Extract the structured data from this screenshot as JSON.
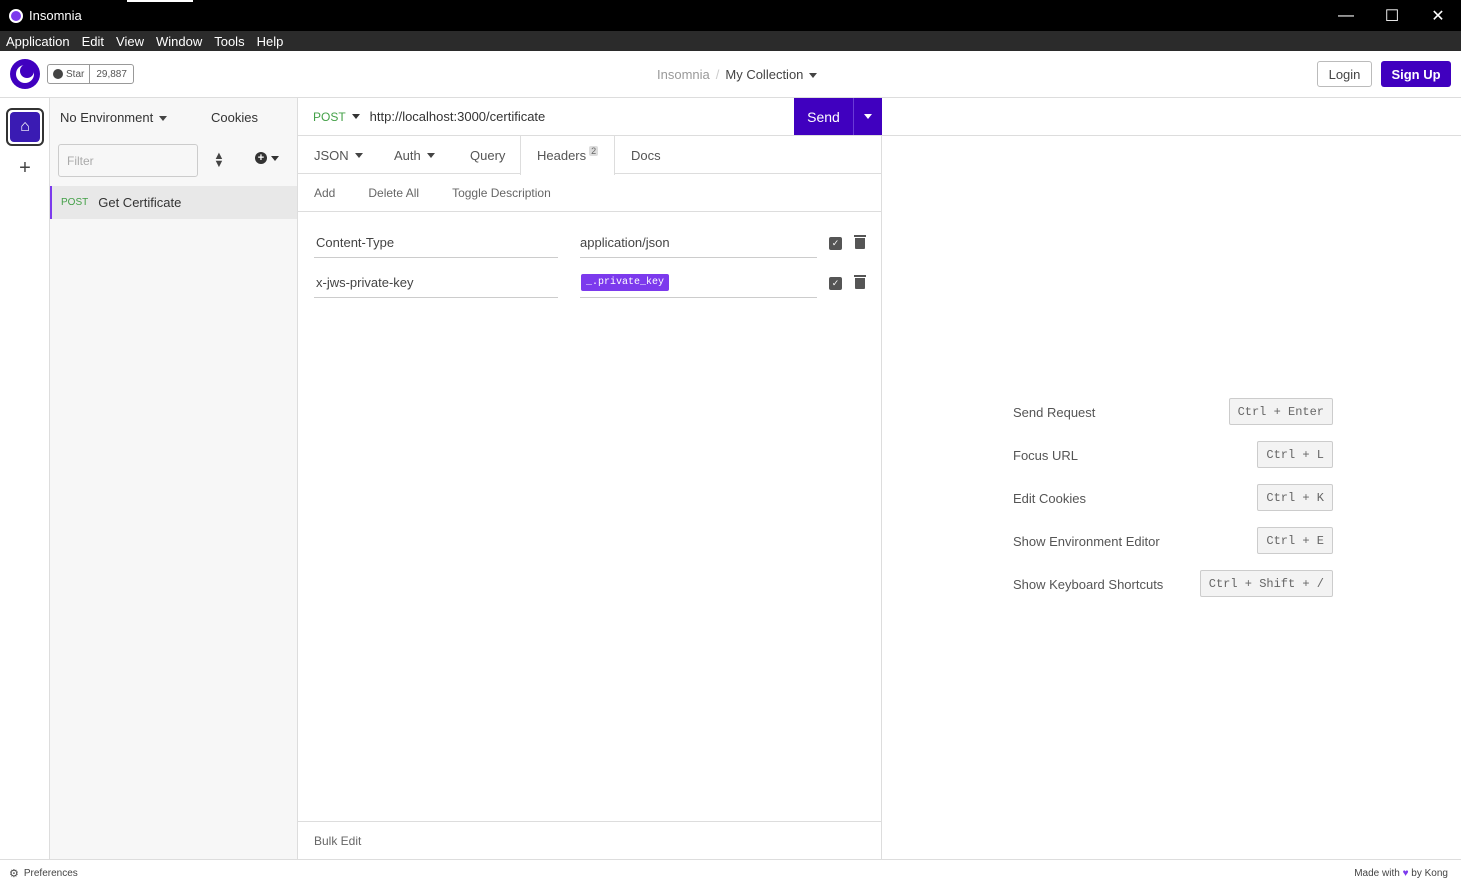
{
  "window": {
    "title": "Insomnia",
    "minimize": "—",
    "maximize": "☐",
    "close": "✕"
  },
  "menu": [
    "Application",
    "Edit",
    "View",
    "Window",
    "Tools",
    "Help"
  ],
  "header": {
    "star_label": "Star",
    "star_count": "29,887",
    "breadcrumb_app": "Insomnia",
    "breadcrumb_sep": "/",
    "breadcrumb_collection": "My Collection",
    "login": "Login",
    "signup": "Sign Up"
  },
  "sidebar": {
    "environment": "No Environment",
    "cookies": "Cookies",
    "filter_placeholder": "Filter",
    "requests": [
      {
        "method": "POST",
        "name": "Get Certificate"
      }
    ]
  },
  "request": {
    "method": "POST",
    "url": "http://localhost:3000/certificate",
    "send": "Send",
    "tabs": {
      "body": "JSON",
      "auth": "Auth",
      "query": "Query",
      "headers": "Headers",
      "headers_count": "2",
      "docs": "Docs"
    },
    "actions": {
      "add": "Add",
      "delete_all": "Delete All",
      "toggle_description": "Toggle Description"
    },
    "headers": [
      {
        "name": "Content-Type",
        "value": "application/json"
      },
      {
        "name": "x-jws-private-key",
        "value": "_.private_key"
      }
    ],
    "bulk_edit": "Bulk Edit"
  },
  "shortcuts": [
    {
      "label": "Send Request",
      "key": "Ctrl + Enter"
    },
    {
      "label": "Focus URL",
      "key": "Ctrl + L"
    },
    {
      "label": "Edit Cookies",
      "key": "Ctrl + K"
    },
    {
      "label": "Show Environment Editor",
      "key": "Ctrl + E"
    },
    {
      "label": "Show Keyboard Shortcuts",
      "key": "Ctrl + Shift + /"
    }
  ],
  "footer": {
    "preferences": "Preferences",
    "made_with": "Made with",
    "by": "by Kong"
  },
  "colors": {
    "accent": "#4000bf",
    "method_post": "#43a047",
    "variable_tag": "#7c3aed"
  },
  "icons": {
    "app": "insomnia-logo-icon",
    "github": "github-icon",
    "home": "home-icon",
    "plus": "plus-icon",
    "sort": "sort-icon",
    "add": "add-circle-icon",
    "checkbox": "checkbox-icon",
    "trash": "trash-icon",
    "gear": "gear-icon",
    "heart": "heart-icon"
  }
}
